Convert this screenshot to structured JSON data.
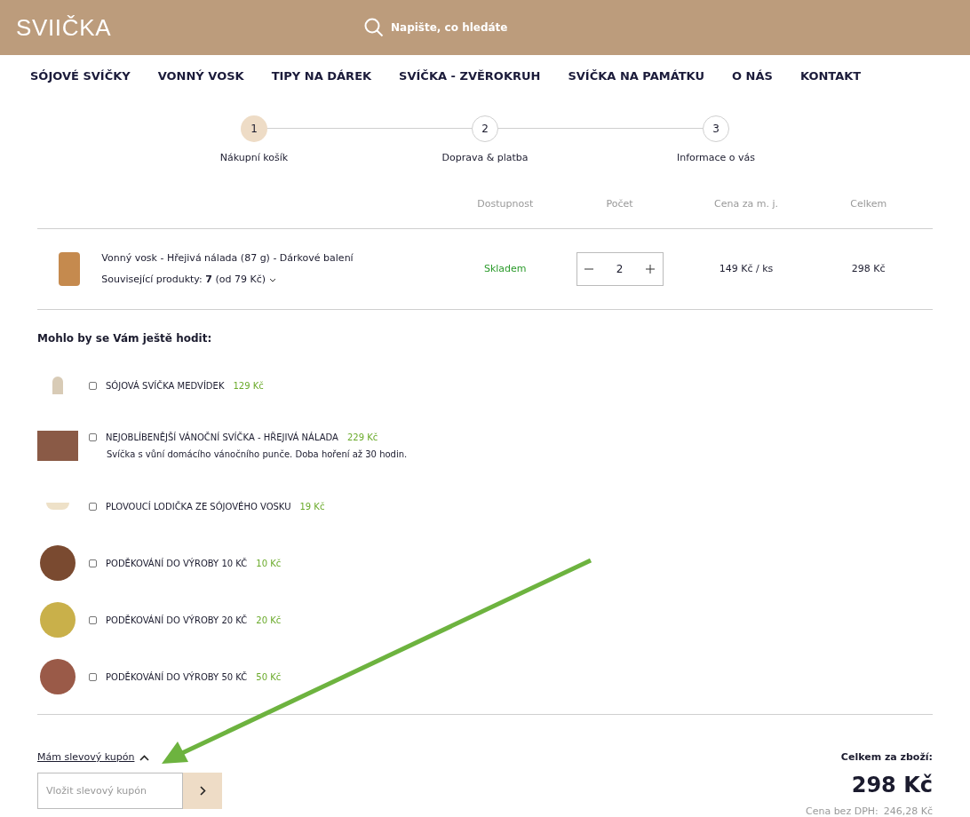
{
  "header": {
    "logo": "SVIIČKA",
    "search": {
      "placeholder": "Napište, co hledáte"
    }
  },
  "nav": [
    "SÓJOVÉ SVÍČKY",
    "VONNÝ VOSK",
    "TIPY NA DÁREK",
    "SVÍČKA - ZVĚROKRUH",
    "SVÍČKA NA PAMÁTKU",
    "O NÁS",
    "KONTAKT"
  ],
  "steps": [
    {
      "number": "1",
      "label": "Nákupní košík",
      "selected": true
    },
    {
      "number": "2",
      "label": "Doprava & platba",
      "selected": false
    },
    {
      "number": "3",
      "label": "Informace o vás",
      "selected": false
    }
  ],
  "table": {
    "columns": [
      "Dostupnost",
      "Počet",
      "Cena za m. j.",
      "Celkem"
    ],
    "rows": [
      {
        "name": "Vonný vosk - Hřejivá nálada (87 g) - Dárkové balení",
        "related": "Související produkty: **7** (od 79 Kč)",
        "availability": "Skladem",
        "quantity": "2",
        "unit_price": "149 Kč / ks",
        "total": "298 Kč"
      }
    ]
  },
  "upsell": {
    "title": "Mohlo by se Vám ještě hodit:",
    "items": [
      {
        "name": "SÓJOVÁ SVÍČKA MEDVÍDEK",
        "price": "129 Kč",
        "checked": false,
        "kind": "candle"
      },
      {
        "name": "NEJOBLÍBENĚJŠÍ VÁNOČNÍ SVÍČKA - HŘEJIVÁ NÁLADA",
        "price": "229 Kč",
        "description": "Svíčka s vůní domácího vánočního punče. Doba hoření až 30 hodin.",
        "checked": false,
        "kind": "photo"
      },
      {
        "name": "PLOVOUCÍ LODIČKA ZE SÓJOVÉHO VOSKU",
        "price": "19 Kč",
        "checked": false,
        "kind": "boat"
      },
      {
        "name": "PODĚKOVÁNÍ DO VÝROBY 10 KČ",
        "price": "10 Kč",
        "checked": false,
        "kind": "coin",
        "color": "#7a4a30"
      },
      {
        "name": "PODĚKOVÁNÍ DO VÝROBY 20 KČ",
        "price": "20 Kč",
        "checked": false,
        "kind": "coin",
        "color": "#c9b04a"
      },
      {
        "name": "PODĚKOVÁNÍ DO VÝROBY 50 KČ",
        "price": "50 Kč",
        "checked": false,
        "kind": "coin",
        "color": "#9a5a48"
      }
    ]
  },
  "coupon": {
    "toggle": "Mám slevový kupón",
    "expanded": true,
    "placeholder": "Vložit slevový kupón"
  },
  "summary": {
    "label": "Celkem za zboží:",
    "total": "298 Kč",
    "net_label": "Cena bez DPH:",
    "net_value": "246,28 Kč"
  }
}
